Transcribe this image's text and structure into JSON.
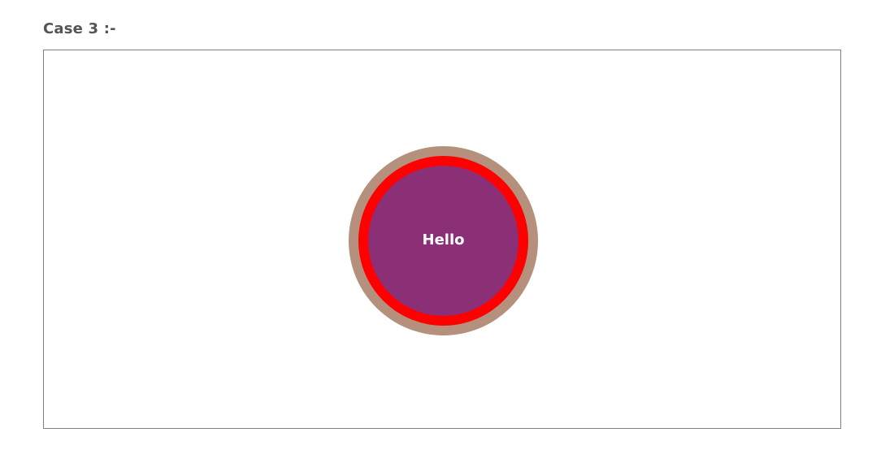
{
  "heading": "Case 3 :-",
  "circle": {
    "label": "Hello"
  },
  "colors": {
    "outer_ring": "#b4907d",
    "middle_ring": "#ff0000",
    "inner_circle": "#8b2f77",
    "label_text": "#ffffff",
    "frame_border": "#7f7f7f",
    "heading_text": "#555555"
  }
}
